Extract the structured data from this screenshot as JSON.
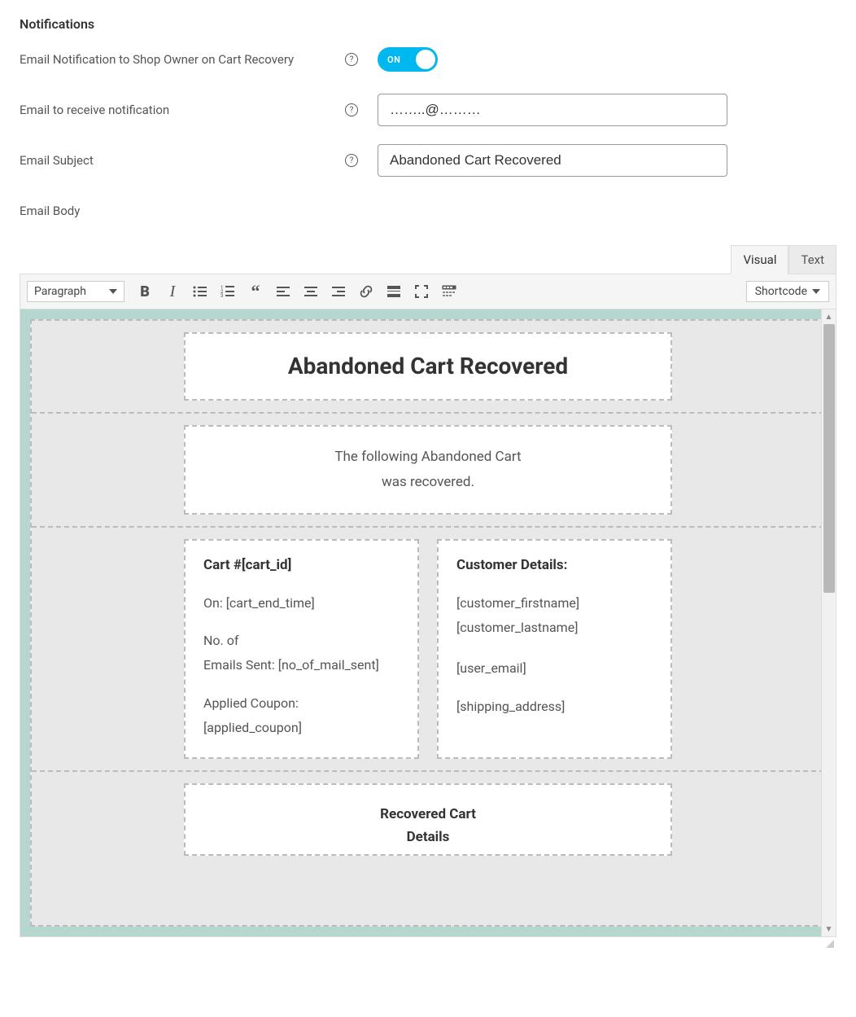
{
  "section_title": "Notifications",
  "rows": {
    "email_owner": {
      "label": "Email Notification to Shop Owner on Cart Recovery",
      "toggle_text": "ON"
    },
    "email_to": {
      "label": "Email to receive notification",
      "value": "……..@………"
    },
    "email_subject": {
      "label": "Email Subject",
      "value": "Abandoned Cart Recovered"
    },
    "email_body": {
      "label": "Email Body"
    }
  },
  "editor": {
    "tabs": {
      "visual": "Visual",
      "text": "Text"
    },
    "format": "Paragraph",
    "shortcode": "Shortcode",
    "content": {
      "title": "Abandoned Cart Recovered",
      "desc1": "The following Abandoned Cart",
      "desc2": "was recovered.",
      "cart_header": "Cart #[cart_id]",
      "cart_on": "On: [cart_end_time]",
      "cart_emails1": "No. of",
      "cart_emails2": "Emails Sent: [no_of_mail_sent]",
      "cart_coupon1": "Applied Coupon:",
      "cart_coupon2": "[applied_coupon]",
      "cust_header": "Customer Details:",
      "cust_first": "[customer_firstname]",
      "cust_last": "[customer_lastname]",
      "cust_email": "[user_email]",
      "cust_ship": "[shipping_address]",
      "recovered1": "Recovered Cart",
      "recovered2": "Details"
    }
  }
}
